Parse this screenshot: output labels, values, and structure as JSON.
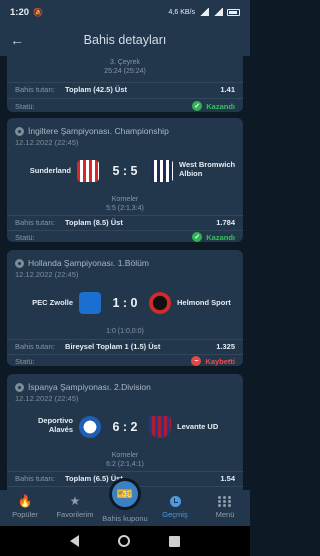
{
  "status_bar": {
    "time": "1:20",
    "network": "4,6 KB/s",
    "battery": ""
  },
  "appbar": {
    "title": "Bahis detayları"
  },
  "labels": {
    "bet_amount": "Bahis tutarı:",
    "status": "Statü:",
    "won": "Kazandı",
    "lost": "Kaybetti"
  },
  "bets": [
    {
      "periods_line1": "3. Çeyrek",
      "periods_line2": "25:24 (25:24)",
      "bet": "Toplam (42.5) Üst",
      "odds": "1.41",
      "status": "Kazandı"
    },
    {
      "league": "İngiltere Şampiyonası. Championship",
      "date": "12.12.2022 (22:45)",
      "home": "Sunderland",
      "away_line1": "West Bromwich",
      "away_line2": "Albion",
      "score": "5 : 5",
      "periods_line1": "Korneler",
      "periods_line2": "5:5 (2:1,3:4)",
      "bet": "Toplam (8.5) Üst",
      "odds": "1.784",
      "status": "Kazandı"
    },
    {
      "league": "Hollanda Şampiyonası. 1.Bölüm",
      "date": "12.12.2022 (22:45)",
      "home": "PEC Zwolle",
      "away": "Helmond Sport",
      "score": "1 : 0",
      "periods_line1": "1:0 (1:0,0:0)",
      "bet": "Bireysel Toplam 1 (1.5) Üst",
      "odds": "1.325",
      "status": "Kaybetti"
    },
    {
      "league": "İspanya Şampiyonası. 2.Division",
      "date": "12.12.2022 (22:45)",
      "home_line1": "Deportivo",
      "home_line2": "Alavés",
      "away": "Levante UD",
      "score": "6 : 2",
      "periods_line1": "Korneler",
      "periods_line2": "6:2 (2:1,4:1)",
      "bet": "Toplam (6.5) Üst",
      "odds": "1.54"
    }
  ],
  "nav": {
    "popular": "Popüler",
    "favorites": "Favorilerim",
    "coupon": "Bahis kuponu",
    "history": "Geçmiş",
    "menu": "Menü"
  },
  "colors": {
    "accent": "#4d9ae6",
    "won": "#36c05a",
    "lost": "#ee4d4d",
    "card": "#22374c",
    "background": "#0d1a26"
  }
}
